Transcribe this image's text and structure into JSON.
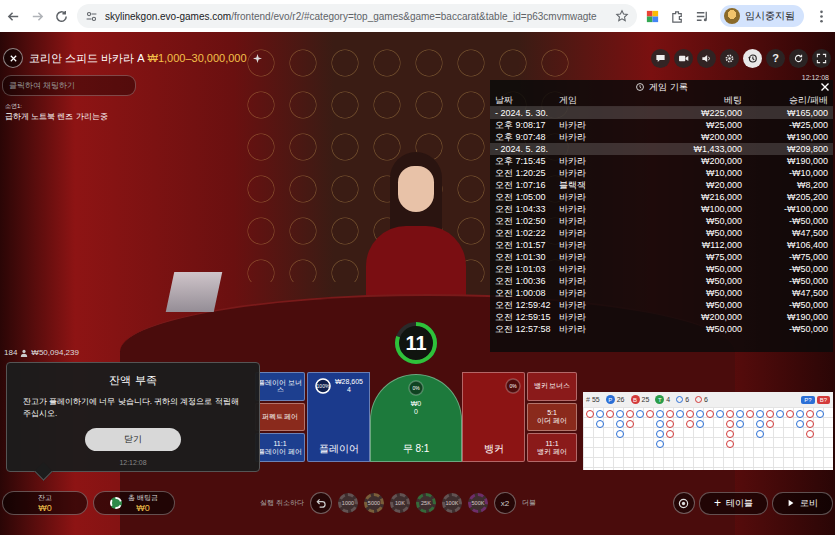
{
  "browser": {
    "url_host": "skylinekgon.evo-games.com",
    "url_path": "/frontend/evo/r2/#category=top_games&game=baccarat&table_id=p63cmvmwagte",
    "profile": "임시중지됨"
  },
  "game": {
    "title": "코리안 스피드 바카라 A",
    "limits": "₩1,000–30,000,000",
    "time": "12:12:08"
  },
  "chat": {
    "placeholder": "클릭하여 채팅하기",
    "messages": [
      {
        "user": "소연1:",
        "text": "급하게 노트북 렌즈 가리는중"
      }
    ]
  },
  "toolbar": [
    {
      "selected": false
    },
    {
      "selected": false
    },
    {
      "selected": false
    },
    {
      "selected": false
    },
    {
      "selected": true
    },
    {
      "selected": false,
      "glyph": "?"
    },
    {
      "selected": false
    },
    {
      "selected": false
    }
  ],
  "history": {
    "title": "게임 기록",
    "columns": [
      "날짜",
      "게임",
      "베팅",
      "승리/패배"
    ],
    "rows": [
      {
        "kind": "group",
        "date": "- 2024. 5. 30.",
        "game": "",
        "bet": "₩225,000",
        "result": "₩165,000"
      },
      {
        "kind": "entry",
        "date": "오후 9:08:17",
        "game": "바카라",
        "bet": "₩25,000",
        "result": "-₩25,000"
      },
      {
        "kind": "entry",
        "date": "오후 9:07:48",
        "game": "바카라",
        "bet": "₩200,000",
        "result": "₩190,000"
      },
      {
        "kind": "group",
        "date": "- 2024. 5. 28.",
        "game": "",
        "bet": "₩1,433,000",
        "result": "₩209,800"
      },
      {
        "kind": "entry",
        "date": "오후 7:15:45",
        "game": "바카라",
        "bet": "₩200,000",
        "result": "₩190,000"
      },
      {
        "kind": "entry",
        "date": "오전 1:20:25",
        "game": "바카라",
        "bet": "₩10,000",
        "result": "-₩10,000"
      },
      {
        "kind": "entry",
        "date": "오전 1:07:16",
        "game": "블랙잭",
        "bet": "₩20,000",
        "result": "₩8,200"
      },
      {
        "kind": "entry",
        "date": "오전 1:05:00",
        "game": "바카라",
        "bet": "₩216,000",
        "result": "₩205,200"
      },
      {
        "kind": "entry",
        "date": "오전 1:04:33",
        "game": "바카라",
        "bet": "₩100,000",
        "result": "-₩100,000"
      },
      {
        "kind": "entry",
        "date": "오전 1:02:50",
        "game": "바카라",
        "bet": "₩50,000",
        "result": "-₩50,000"
      },
      {
        "kind": "entry",
        "date": "오전 1:02:22",
        "game": "바카라",
        "bet": "₩50,000",
        "result": "₩47,500"
      },
      {
        "kind": "entry",
        "date": "오전 1:01:57",
        "game": "바카라",
        "bet": "₩112,000",
        "result": "₩106,400"
      },
      {
        "kind": "entry",
        "date": "오전 1:01:30",
        "game": "바카라",
        "bet": "₩75,000",
        "result": "-₩75,000"
      },
      {
        "kind": "entry",
        "date": "오전 1:01:03",
        "game": "바카라",
        "bet": "₩50,000",
        "result": "-₩50,000"
      },
      {
        "kind": "entry",
        "date": "오전 1:00:36",
        "game": "바카라",
        "bet": "₩50,000",
        "result": "-₩50,000"
      },
      {
        "kind": "entry",
        "date": "오전 1:00:08",
        "game": "바카라",
        "bet": "₩50,000",
        "result": "₩47,500"
      },
      {
        "kind": "entry",
        "date": "오전 12:59:42",
        "game": "바카라",
        "bet": "₩50,000",
        "result": "-₩50,000"
      },
      {
        "kind": "entry",
        "date": "오전 12:59:15",
        "game": "바카라",
        "bet": "₩200,000",
        "result": "₩190,000"
      },
      {
        "kind": "entry",
        "date": "오전 12:57:58",
        "game": "바카라",
        "bet": "₩50,000",
        "result": "-₩50,000"
      }
    ]
  },
  "timer": {
    "seconds": "11",
    "level": 0.8
  },
  "table_stats": {
    "players": "184",
    "total": "₩50,094,239"
  },
  "side_bets_left": [
    {
      "odds": "",
      "name": "플레이어 보너스",
      "color": "#1d3f8f"
    },
    {
      "odds": "",
      "name": "퍼펙트 페어",
      "color": "#8a2a1c"
    },
    {
      "odds": "11:1",
      "name": "플레이어 페어",
      "color": "#1d3f8f"
    }
  ],
  "side_bets_right": [
    {
      "odds": "",
      "name": "뱅커 보너스",
      "color": "#8a1a1a"
    },
    {
      "odds": "5:1",
      "name": "이더 페어",
      "color": "#8a2a1c"
    },
    {
      "odds": "11:1",
      "name": "뱅커 페어",
      "color": "#8a1a1a"
    }
  ],
  "main_bets": [
    {
      "kind": "player",
      "label": "플레이어",
      "percent": "100%",
      "level": 1,
      "amount": "₩28,605",
      "count": "4",
      "color": "#1b3a8c"
    },
    {
      "kind": "tie",
      "label": "무 8:1",
      "percent": "0%",
      "level": 0,
      "amount": "₩0",
      "count": "0",
      "color": "#1d7a3c"
    },
    {
      "kind": "banker",
      "label": "뱅커",
      "percent": "0%",
      "level": 0,
      "amount": "",
      "count": "",
      "color": "#8c1414"
    }
  ],
  "dialog": {
    "title": "잔액 부족",
    "message": "잔고가 플레이하기에 너무 낮습니다. 귀하의 계정으로 적립해 주십시오.",
    "button": "닫기",
    "time": "12:12:08"
  },
  "roadmap": {
    "counts": [
      {
        "kind": "plain",
        "label": "#",
        "value": "55",
        "color": "#555555"
      },
      {
        "kind": "badge",
        "label": "P",
        "value": "26",
        "color": "#2b6fd6"
      },
      {
        "kind": "badge",
        "label": "B",
        "value": "25",
        "color": "#d33a3a"
      },
      {
        "kind": "badge",
        "label": "T",
        "value": "4",
        "color": "#2a9d4a"
      },
      {
        "kind": "dot",
        "label": "",
        "value": "6",
        "color": "#2b6fd6"
      },
      {
        "kind": "dot",
        "label": "",
        "value": "6",
        "color": "#d33a3a"
      }
    ],
    "predict": [
      {
        "label": "P?",
        "color": "#2b6fd6"
      },
      {
        "label": "B?",
        "color": "#d33a3a"
      }
    ],
    "columns": [
      "B",
      "PP",
      "B",
      "PPP",
      "BB",
      "P",
      "B",
      "PPPP",
      "BBB",
      "P",
      "BB",
      "PP",
      "B",
      "P",
      "BBBB",
      "PP",
      "B",
      "PPP",
      "BB",
      "P",
      "B",
      "PP",
      "BBB",
      "P"
    ]
  },
  "bottom": {
    "balance_label": "잔고",
    "balance": "₩0",
    "total_label": "총 배팅금",
    "total": "₩0",
    "undo": "실행 취소하다",
    "double_key": "x2",
    "double": "더블",
    "tables": "테이블",
    "tables_glyph": "+",
    "lobby": "로비"
  },
  "chips": [
    {
      "value": "1000",
      "color": "#6b6b6b",
      "selected": false
    },
    {
      "value": "5000",
      "color": "#8a7a4a",
      "selected": false
    },
    {
      "value": "10K",
      "color": "#6b6b6b",
      "selected": false
    },
    {
      "value": "25K",
      "color": "#2f8a4a",
      "selected": false
    },
    {
      "value": "100K",
      "color": "#6b6b6b",
      "selected": false
    },
    {
      "value": "500K",
      "color": "#7a3a8a",
      "selected": false
    }
  ]
}
